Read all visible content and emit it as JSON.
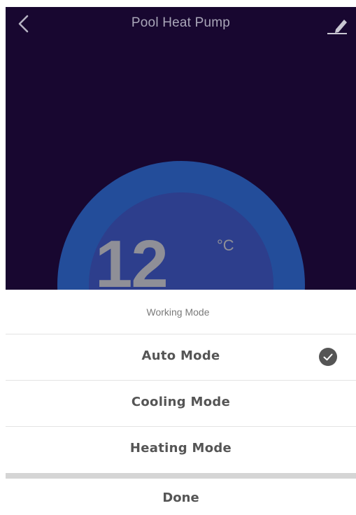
{
  "header": {
    "title": "Pool Heat Pump",
    "back_icon": "chevron-left-icon",
    "edit_icon": "pencil-icon"
  },
  "dial": {
    "temperature": "12",
    "unit": "°C"
  },
  "sheet": {
    "title": "Working Mode",
    "options": [
      {
        "label": "Auto Mode",
        "selected": true
      },
      {
        "label": "Cooling Mode",
        "selected": false
      },
      {
        "label": "Heating Mode",
        "selected": false
      }
    ],
    "done_label": "Done",
    "selected_icon": "checkmark-icon"
  },
  "colors": {
    "app_background": "#180730",
    "dial_outer": "#234d9a",
    "dial_inner": "#2d3e8c",
    "sheet_text": "#555555"
  }
}
